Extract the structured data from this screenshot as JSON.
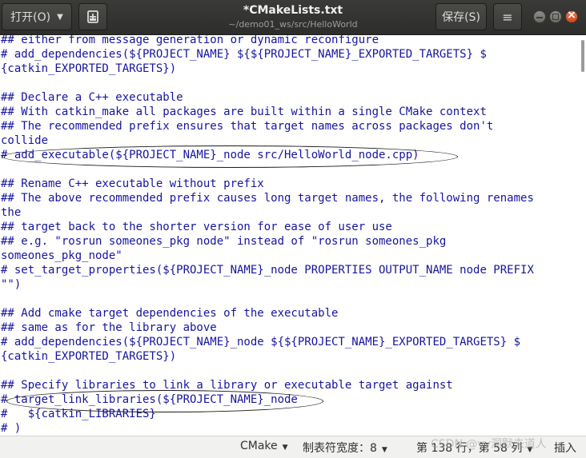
{
  "header": {
    "open_label": "打开(O)",
    "title": "*CMakeLists.txt",
    "subtitle": "~/demo01_ws/src/HelloWorld",
    "save_label": "保存(S)",
    "menu_icon": "≡"
  },
  "editor": {
    "lines": [
      "## either from message generation or dynamic reconfigure",
      "# add_dependencies(${PROJECT_NAME} ${${PROJECT_NAME}_EXPORTED_TARGETS} $",
      "{catkin_EXPORTED_TARGETS})",
      "",
      "## Declare a C++ executable",
      "## With catkin_make all packages are built within a single CMake context",
      "## The recommended prefix ensures that target names across packages don't",
      "collide",
      "# add_executable(${PROJECT_NAME}_node src/HelloWorld_node.cpp)",
      "",
      "## Rename C++ executable without prefix",
      "## The above recommended prefix causes long target names, the following renames",
      "the",
      "## target back to the shorter version for ease of user use",
      "## e.g. \"rosrun someones_pkg node\" instead of \"rosrun someones_pkg",
      "someones_pkg_node\"",
      "# set_target_properties(${PROJECT_NAME}_node PROPERTIES OUTPUT_NAME node PREFIX",
      "\"\")",
      "",
      "## Add cmake target dependencies of the executable",
      "## same as for the library above",
      "# add_dependencies(${PROJECT_NAME}_node ${${PROJECT_NAME}_EXPORTED_TARGETS} $",
      "{catkin_EXPORTED_TARGETS})",
      "",
      "## Specify libraries to link a library or executable target against",
      "# target_link_libraries(${PROJECT_NAME}_node",
      "#   ${catkin_LIBRARIES}",
      "# )"
    ]
  },
  "status": {
    "language": "CMake",
    "tab_width": "制表符宽度：8",
    "position": "第 138 行，第 58 列",
    "insert_mode": "插入"
  },
  "watermark": "CSDN @vv洞默未道人"
}
